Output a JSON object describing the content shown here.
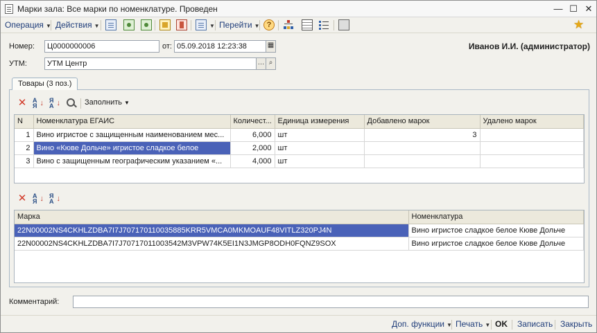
{
  "window": {
    "title": "Марки зала: Все марки по номенклатуре. Проведен",
    "minimize": "—",
    "maximize": "☐",
    "close": "✕"
  },
  "toolbar": {
    "operation": "Операция",
    "actions": "Действия",
    "goto": "Перейти",
    "help": "?"
  },
  "header": {
    "number_label": "Номер:",
    "number_value": "Ц0000000006",
    "date_label": "от:",
    "date_value": "05.09.2018 12:23:38",
    "utm_label": "УТМ:",
    "utm_value": "УТМ Центр",
    "user": "Иванов И.И. (администратор)"
  },
  "tab": {
    "label": "Товары (3 поз.)"
  },
  "goods_toolbar": {
    "fill": "Заполнить"
  },
  "goods_table": {
    "columns": [
      "N",
      "Номенклатура ЕГАИС",
      "Количест...",
      "Единица измерения",
      "Добавлено марок",
      "Удалено марок"
    ],
    "rows": [
      {
        "n": "1",
        "name": "Вино игристое с защищенным наименованием мес...",
        "qty": "6,000",
        "unit": "шт",
        "added": "3",
        "removed": ""
      },
      {
        "n": "2",
        "name": "Вино «Кюве Дольче» игристое сладкое белое",
        "qty": "2,000",
        "unit": "шт",
        "added": "",
        "removed": ""
      },
      {
        "n": "3",
        "name": "Вино с защищенным географическим указанием «...",
        "qty": "4,000",
        "unit": "шт",
        "added": "",
        "removed": ""
      }
    ]
  },
  "marks_table": {
    "columns": [
      "Марка",
      "Номенклатура"
    ],
    "rows": [
      {
        "mark": "22N00002NS4CKHLZDBA7I7J70717011003588 5KRR5VMCA0MKMOAUF48VITLZ320PJ4N",
        "nom": "Вино игристое сладкое белое Кюве Дольче"
      },
      {
        "mark": "22N00002NS4CKHLZDBA7I7J70717011003542M3VPW74K5EI1N3JMGP8ODH0FQNZ9SOX",
        "nom": "Вино игристое сладкое белое Кюве Дольче"
      }
    ]
  },
  "comment": {
    "label": "Комментарий:",
    "value": ""
  },
  "bottom": {
    "dop": "Доп. функции",
    "print": "Печать",
    "ok": "OK",
    "save": "Записать",
    "close": "Закрыть"
  }
}
